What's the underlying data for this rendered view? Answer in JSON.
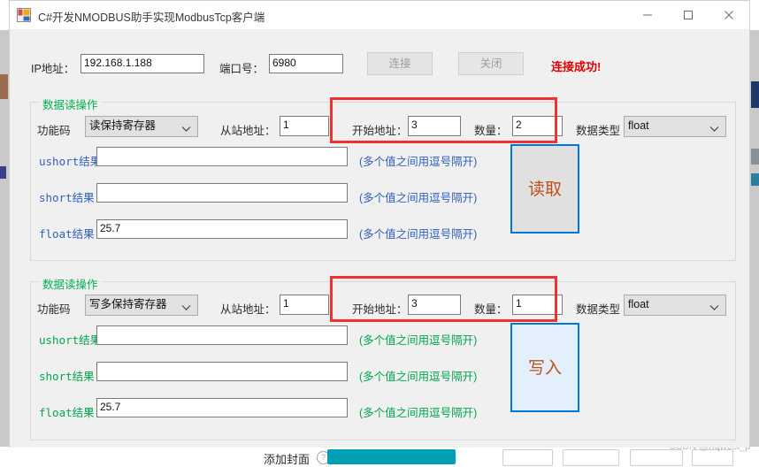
{
  "window": {
    "title": "C#开发NMODBUS助手实现ModbusTcp客户端",
    "icon": "winforms-app-icon",
    "minimize_label": "minimize-icon",
    "maximize_label": "maximize-icon",
    "close_label": "close-icon"
  },
  "connection": {
    "ip_label": "IP地址：",
    "ip_value": "192.168.1.188",
    "ip_placeholder": "",
    "port_label": "端口号：",
    "port_value": "6980",
    "port_placeholder": "",
    "connect_label": "连接",
    "connect_disabled": true,
    "close_label": "关闭",
    "status_text": "连接成功!",
    "status_color": "#e00000"
  },
  "read_group": {
    "title": "数据读操作",
    "title_color": "#00b050",
    "func_label": "功能码",
    "func_value": "读保持寄存器",
    "slave_label": "从站地址：",
    "slave_value": "1",
    "start_label": "开始地址：",
    "start_value": "3",
    "count_label": "数量：",
    "count_value": "2",
    "datatype_label": "数据类型",
    "datatype_value": "float",
    "rows": [
      {
        "label": "ushort结果",
        "value": "",
        "hint": "(多个值之间用逗号隔开)"
      },
      {
        "label": "short结果",
        "value": "",
        "hint": "(多个值之间用逗号隔开)"
      },
      {
        "label": "float结果",
        "value": "25.7",
        "hint": "(多个值之间用逗号隔开)"
      }
    ],
    "label_color": "#2f5fbf",
    "action_label": "读取",
    "action_bg": "#e0e0e0",
    "action_border": "#0078d7",
    "action_text_color": "#c0501a"
  },
  "write_group": {
    "title": "数据读操作",
    "title_color": "#00b050",
    "func_label": "功能码",
    "func_value": "写多保持寄存器",
    "slave_label": "从站地址：",
    "slave_value": "1",
    "start_label": "开始地址：",
    "start_value": "3",
    "count_label": "数量：",
    "count_value": "1",
    "datatype_label": "数据类型",
    "datatype_value": "float",
    "rows": [
      {
        "label": "ushort结果",
        "value": "",
        "hint": "(多个值之间用逗号隔开)"
      },
      {
        "label": "short结果",
        "value": "",
        "hint": "(多个值之间用逗号隔开)"
      },
      {
        "label": "float结果",
        "value": "25.7",
        "hint": "(多个值之间用逗号隔开)"
      }
    ],
    "label_color": "#00a64f",
    "action_label": "写入",
    "action_bg": "#e3f0fb",
    "action_border": "#0078d7",
    "action_text_color": "#c0501a"
  },
  "background": {
    "cover_label": "添加封面",
    "help_glyph": "?",
    "watermark": "CSDN @hqwest_p"
  }
}
